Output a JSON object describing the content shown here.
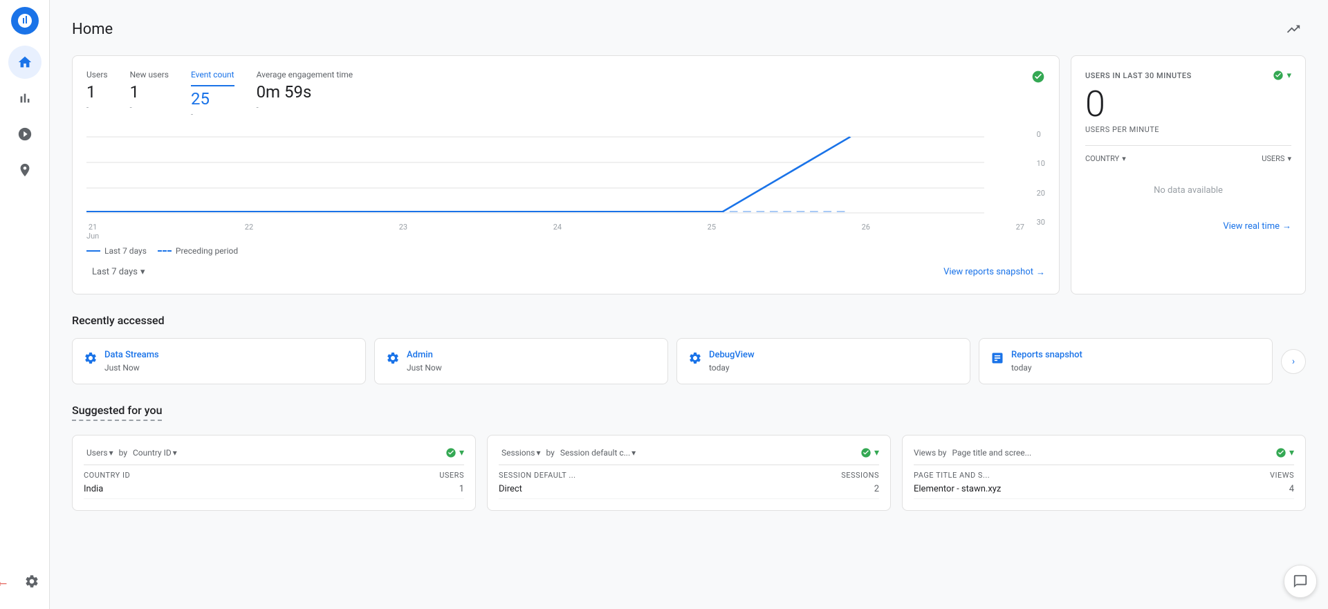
{
  "page": {
    "title": "Home"
  },
  "sidebar": {
    "logo_alt": "Google Analytics",
    "items": [
      {
        "id": "home",
        "icon": "home",
        "label": "Home",
        "active": true
      },
      {
        "id": "reports",
        "icon": "bar-chart",
        "label": "Reports"
      },
      {
        "id": "explore",
        "icon": "search-analytics",
        "label": "Explore"
      },
      {
        "id": "advertising",
        "icon": "target",
        "label": "Advertising"
      }
    ],
    "bottom_items": [
      {
        "id": "settings",
        "icon": "gear",
        "label": "Admin"
      }
    ]
  },
  "overview": {
    "metrics": [
      {
        "id": "users",
        "label": "Users",
        "value": "1",
        "sub": "-",
        "active": false
      },
      {
        "id": "new-users",
        "label": "New users",
        "value": "1",
        "sub": "-",
        "active": false
      },
      {
        "id": "event-count",
        "label": "Event count",
        "value": "25",
        "sub": "-",
        "active": true
      },
      {
        "id": "avg-engagement",
        "label": "Average engagement time",
        "value": "0m 59s",
        "sub": "-",
        "active": false
      }
    ],
    "chart": {
      "x_labels": [
        "21\nJun",
        "22",
        "23",
        "24",
        "25",
        "26",
        "27"
      ],
      "y_labels": [
        "30",
        "20",
        "10",
        "0"
      ],
      "legend": [
        {
          "id": "last7days",
          "label": "Last 7 days",
          "style": "solid"
        },
        {
          "id": "preceding",
          "label": "Preceding period",
          "style": "dashed"
        }
      ]
    },
    "date_range": "Last 7 days",
    "view_link": "View reports snapshot →"
  },
  "realtime": {
    "title": "USERS IN LAST 30 MINUTES",
    "value": "0",
    "sub_label": "USERS PER MINUTE",
    "country_col": "COUNTRY",
    "users_col": "USERS",
    "no_data": "No data available",
    "view_link": "View real time →",
    "status_icon": "check-circle"
  },
  "recently_accessed": {
    "title": "Recently accessed",
    "items": [
      {
        "id": "data-streams",
        "name": "Data Streams",
        "time": "Just Now",
        "icon": "gear"
      },
      {
        "id": "admin",
        "name": "Admin",
        "time": "Just Now",
        "icon": "gear"
      },
      {
        "id": "debug-view",
        "name": "DebugView",
        "time": "today",
        "icon": "gear"
      },
      {
        "id": "reports-snapshot",
        "name": "Reports snapshot",
        "time": "today",
        "icon": "bar-chart-box"
      }
    ],
    "nav_next": "›"
  },
  "suggested": {
    "title": "Suggested for you",
    "cards": [
      {
        "id": "users-by-country",
        "title_parts": [
          "Users",
          "by",
          "Country ID"
        ],
        "col1_header": "COUNTRY ID",
        "col2_header": "USERS",
        "rows": [
          {
            "col1": "India",
            "col2": "1"
          }
        ]
      },
      {
        "id": "sessions-by-session-default",
        "title_parts": [
          "Sessions",
          "by",
          "Session default c..."
        ],
        "col1_header": "SESSION DEFAULT ...",
        "col2_header": "SESSIONS",
        "rows": [
          {
            "col1": "Direct",
            "col2": "2"
          }
        ]
      },
      {
        "id": "views-by-page-title",
        "title_parts": [
          "Views by",
          "Page title and scree..."
        ],
        "col1_header": "PAGE TITLE AND S...",
        "col2_header": "VIEWS",
        "rows": [
          {
            "col1": "Elementor - stawn.xyz",
            "col2": "4"
          }
        ]
      }
    ]
  },
  "icons": {
    "check_circle": "✓",
    "chevron_down": "▾",
    "chevron_right": "›",
    "arrow_right": "→",
    "gear": "⚙",
    "home": "⌂",
    "bar_chart": "▦",
    "search": "⊙",
    "target": "◎",
    "edit": "✎",
    "chat": "💬"
  },
  "colors": {
    "blue": "#1a73e8",
    "green": "#34a853",
    "gray": "#5f6368",
    "light_gray": "#9aa0a6",
    "red_arrow": "#d93025"
  }
}
